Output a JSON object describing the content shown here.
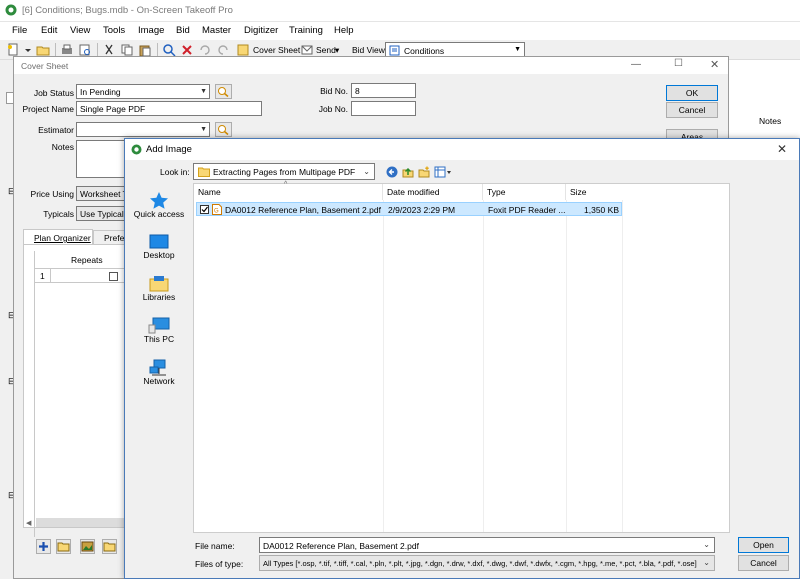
{
  "app": {
    "title": "[6] Conditions; Bugs.mdb - On-Screen Takeoff Pro",
    "menu": [
      "File",
      "Edit",
      "View",
      "Tools",
      "Image",
      "Bid",
      "Master",
      "Digitizer",
      "Training",
      "Help"
    ],
    "toolbar": {
      "cover_sheet": "Cover Sheet",
      "send": "Send",
      "bid_view": "Bid View",
      "conditions": "Conditions"
    },
    "notes_header": "Notes"
  },
  "cover": {
    "title": "Cover Sheet",
    "job_status_label": "Job Status",
    "job_status_value": "In Pending",
    "project_name_label": "Project Name",
    "project_name_value": "Single Page PDF",
    "estimator_label": "Estimator",
    "estimator_value": "",
    "notes_label": "Notes",
    "bid_no_label": "Bid No.",
    "bid_no_value": "8",
    "job_no_label": "Job No.",
    "job_no_value": "",
    "ok": "OK",
    "cancel": "Cancel",
    "areas": "Areas",
    "price_using_label": "Price Using",
    "price_using_value": "Worksheet T",
    "typicals_label": "Typicals",
    "typicals_value": "Use Typical C",
    "tabs": [
      "Plan Organizer",
      "Prefer"
    ],
    "grid_header": "Repeats",
    "grid_row": "1"
  },
  "dialog": {
    "title": "Add Image",
    "look_in_label": "Look in:",
    "look_in_value": "Extracting Pages from Multipage PDF",
    "places": [
      "Quick access",
      "Desktop",
      "Libraries",
      "This PC",
      "Network"
    ],
    "columns": [
      "Name",
      "Date modified",
      "Type",
      "Size"
    ],
    "files": [
      {
        "name": "DA0012 Reference Plan, Basement 2.pdf",
        "date": "2/9/2023 2:29 PM",
        "type": "Foxit PDF Reader ...",
        "size": "1,350 KB"
      }
    ],
    "file_name_label": "File name:",
    "file_name_value": "DA0012 Reference Plan, Basement 2.pdf",
    "file_type_label": "Files of type:",
    "file_type_value": "All Types [*.osp, *.tif, *.tiff, *.cal, *.pln, *.plt, *.jpg, *.dgn, *.drw, *.dxf, *.dwg, *.dwf, *.dwfx, *.cgm, *.hpg, *.me, *.pct, *.bla, *.pdf, *.ose]",
    "open": "Open",
    "cancel": "Cancel"
  },
  "colors": {
    "accent": "#0078d7",
    "selection": "#cce8ff",
    "folder": "#f8d775"
  }
}
